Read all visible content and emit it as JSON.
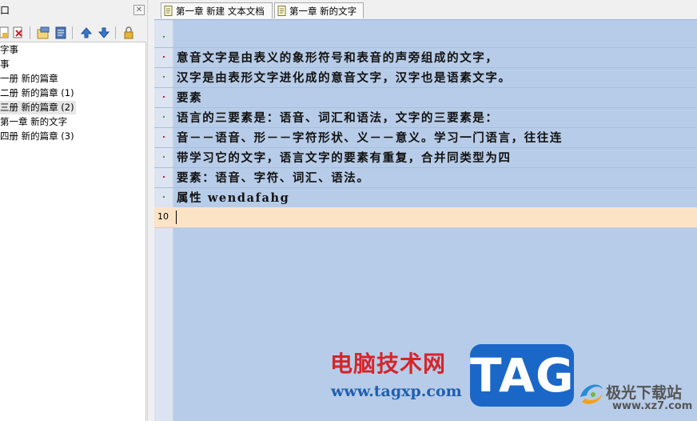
{
  "left_panel": {
    "title": "窗口",
    "title_visible": "口",
    "close_glyph": "⊠",
    "toolbar_icons": [
      "new-file-icon",
      "delete-icon",
      "properties-icon",
      "notes-icon",
      "move-up-icon",
      "move-down-icon",
      "lock-icon"
    ],
    "tree_items": [
      {
        "label": "字事"
      },
      {
        "label": "事"
      },
      {
        "label": "一册 新的篇章"
      },
      {
        "label": "二册 新的篇章 (1)"
      },
      {
        "label": "三册 新的篇章 (2)",
        "selected": true
      },
      {
        "label": "第一章 新的文字"
      },
      {
        "label": "四册 新的篇章 (3)"
      }
    ]
  },
  "tabs": [
    {
      "label": "第一章 新建 文本文档"
    },
    {
      "label": "第一章 新的文字"
    }
  ],
  "editor": {
    "lines": [
      {
        "text": "",
        "marker": "·"
      },
      {
        "text": "意音文字是由表义的象形符号和表音的声旁组成的文字，",
        "marker": "·"
      },
      {
        "text": "汉字是由表形文字进化成的意音文字，汉字也是语素文字。",
        "marker": "·"
      },
      {
        "text": "要素",
        "marker": "·"
      },
      {
        "text": "语言的三要素是：语音、词汇和语法，文字的三要素是：",
        "marker": "·"
      },
      {
        "text": "音－－语音、形－－字符形状、义－－意义。学习一门语言，往往连",
        "marker": "·"
      },
      {
        "text": "带学习它的文字，语言文字的要素有重复，合并同类型为四",
        "marker": "·"
      },
      {
        "text": "要素：语音、字符、词汇、语法。",
        "marker": "·"
      },
      {
        "text": "属性 wendafahg",
        "marker": "·"
      },
      {
        "text": "",
        "line_number": "10",
        "current": true
      }
    ],
    "colors": {
      "background": "#b7cce8",
      "current_line": "#fde3c6",
      "marker_green": "#3a9a3a",
      "marker_red": "#c02020"
    }
  },
  "watermark": {
    "site_cn": "电脑技术网",
    "site_url": "www.tagxp.com",
    "tag": "TAG",
    "brand_cn": "极光下载站",
    "brand_url": "www.xz7.com"
  }
}
